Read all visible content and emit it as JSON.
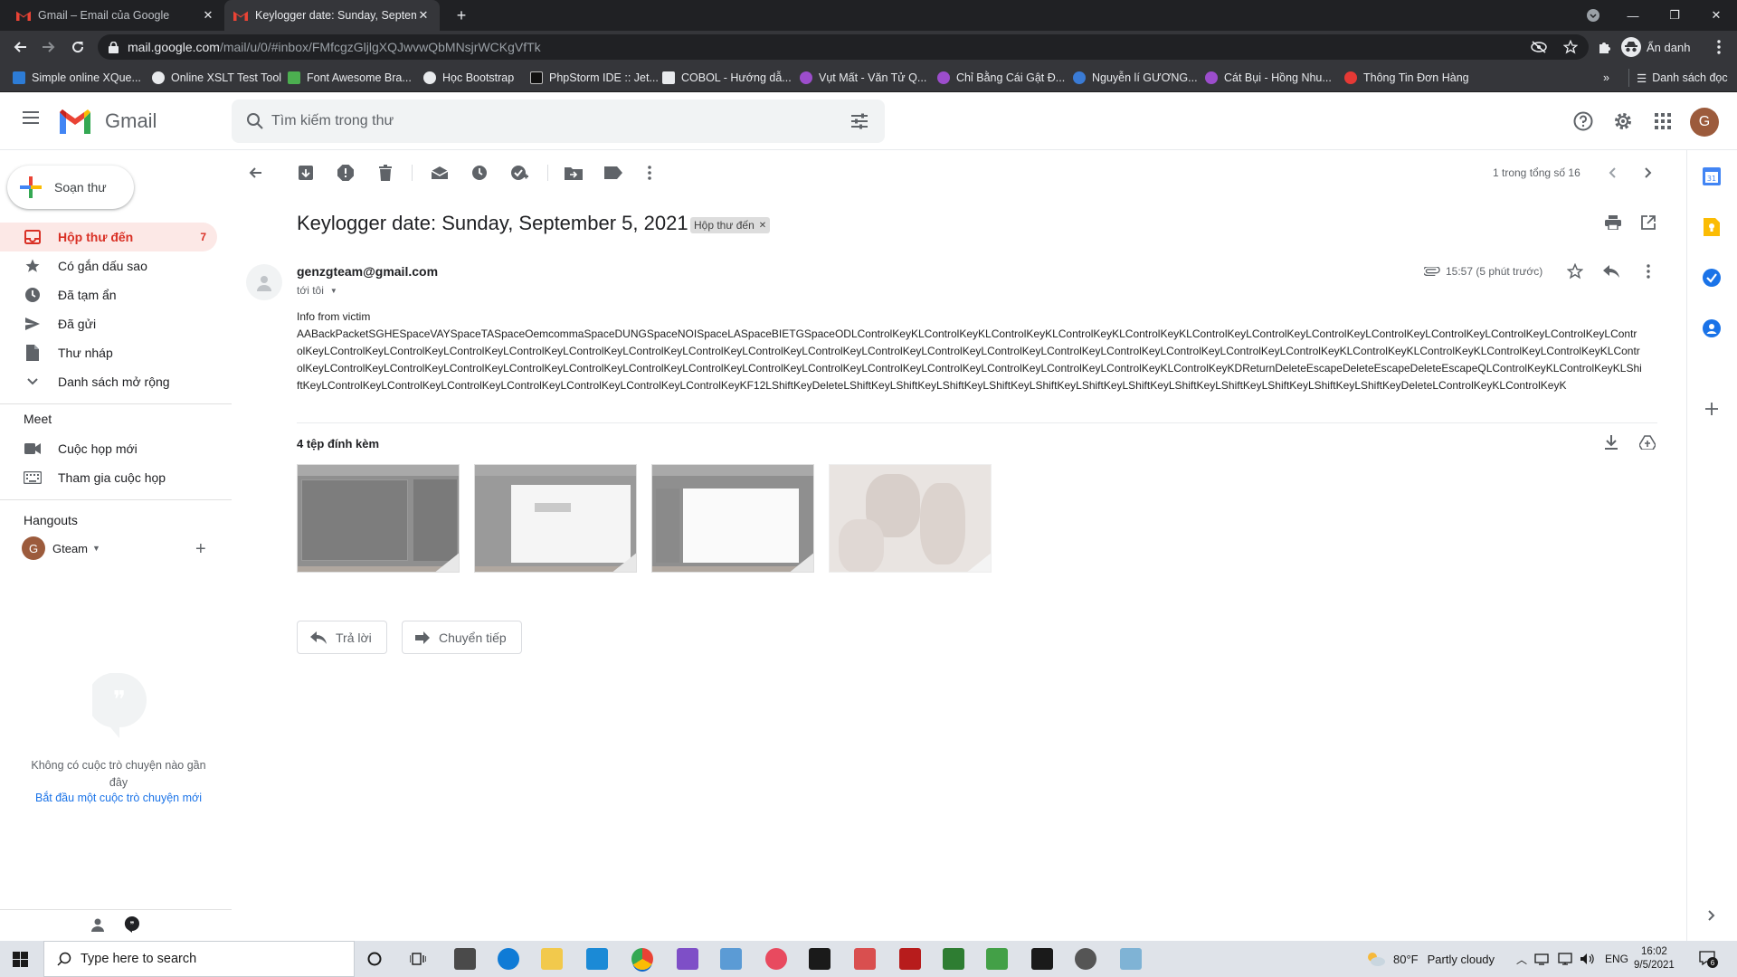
{
  "browser": {
    "tabs": [
      {
        "title": "Gmail – Email của Google",
        "active": false
      },
      {
        "title": "Keylogger date: Sunday, Septem",
        "active": true
      }
    ],
    "url_host": "mail.google.com",
    "url_path": "/mail/u/0/#inbox/FMfcgzGljlgXQJwvwQbMNsjrWCKgVfTk",
    "profile_label": "Ẩn danh",
    "bookmarks": [
      "Simple online XQue...",
      "Online XSLT Test Tool",
      "Font Awesome Bra...",
      "Học Bootstrap",
      "PhpStorm IDE :: Jet...",
      "COBOL - Hướng dẫ...",
      "Vụt Mất - Văn Tử Q...",
      "Chỉ Bằng Cái Gật Đ...",
      "Nguyễn lí GƯƠNG...",
      "Cát Bụi - Hồng Nhu...",
      "Thông Tin Đơn Hàng"
    ],
    "bookmarks_overflow": "»",
    "reading_list": "Danh sách đọc"
  },
  "gmail": {
    "logo_text": "Gmail",
    "search_placeholder": "Tìm kiếm trong thư",
    "account_initial": "G",
    "compose_label": "Soạn thư",
    "nav": [
      {
        "label": "Hộp thư đến",
        "count": "7",
        "icon": "inbox-icon"
      },
      {
        "label": "Có gắn dấu sao",
        "icon": "star-icon"
      },
      {
        "label": "Đã tạm ẩn",
        "icon": "clock-icon"
      },
      {
        "label": "Đã gửi",
        "icon": "send-icon"
      },
      {
        "label": "Thư nháp",
        "icon": "draft-icon"
      },
      {
        "label": "Danh sách mở rộng",
        "icon": "chevron-down-icon"
      }
    ],
    "meet": {
      "heading": "Meet",
      "items": [
        "Cuộc họp mới",
        "Tham gia cuộc họp"
      ]
    },
    "hangouts": {
      "heading": "Hangouts",
      "user": "Gteam",
      "user_initial": "G",
      "empty_text": "Không có cuộc trò chuyện nào gần đây",
      "start_link": "Bắt đầu một cuộc trò chuyện mới"
    },
    "pagination": "1 trong tổng số 16",
    "message": {
      "subject": "Keylogger date: Sunday, September 5, 2021",
      "label": "Hộp thư đến",
      "sender": "genzgteam@gmail.com",
      "to": "tới tôi",
      "time": "15:57 (5 phút trước)",
      "body_line1": "Info from victim",
      "body": "AABackPacketSGHESpaceVAYSpaceTASpaceOemcommaSpaceDUNGSpaceNOISpaceLASpaceBIETGSpaceODLControlKeyKLControlKeyKLControlKeyKLControlKeyKLControlKeyKLControlKeyLControlKeyLControlKeyLControlKeyLControlKeyLControlKeyLControlKeyLControlKeyLControlKeyLControlKeyLControlKeyLControlKeyLControlKeyLControlKeyLControlKeyLControlKeyLControlKeyLControlKeyLControlKeyLControlKeyLControlKeyLControlKeyLControlKeyLControlKeyLControlKeyKLControlKeyKLControlKeyKLControlKeyLControlKeyKLControlKeyLControlKeyLControlKeyLControlKeyLControlKeyLControlKeyLControlKeyLControlKeyLControlKeyLControlKeyLControlKeyLControlKeyLControlKeyLControlKeyLControlKeyKLControlKeyKDReturnDeleteEscapeDeleteEscapeDeleteEscapeQLControlKeyKLControlKeyKLShiftKeyLControlKeyLControlKeyLControlKeyLControlKeyLControlKeyLControlKeyLControlKeyKF12LShiftKeyDeleteLShiftKeyLShiftKeyLShiftKeyLShiftKeyLShiftKeyLShiftKeyLShiftKeyLShiftKeyLShiftKeyLShiftKeyLShiftKeyLShiftKeyDeleteLControlKeyKLControlKeyK",
      "attachments_heading": "4 tệp đính kèm",
      "reply_label": "Trả lời",
      "forward_label": "Chuyển tiếp"
    }
  },
  "taskbar": {
    "search_placeholder": "Type here to search",
    "weather_temp": "80°F",
    "weather_text": "Partly cloudy",
    "lang": "ENG",
    "time": "16:02",
    "date": "9/5/2021",
    "notif_count": "6"
  },
  "colors": {
    "gmail_red": "#d93025",
    "inbox_active_bg": "#fce8e6",
    "link_blue": "#1a73e8",
    "chrome_dark": "#202124"
  }
}
